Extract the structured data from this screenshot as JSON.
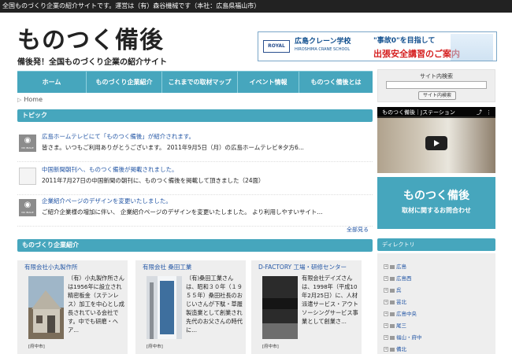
{
  "topbar": {
    "text": "全国ものづくり企業の紹介サイトです。運営は（有）森谷機械です（本社：広島県福山市）"
  },
  "logo": {
    "title": "ものつく備後",
    "subtitle": "備後発！全国ものづくり企業の紹介サイト"
  },
  "banner": {
    "royal": "ROYAL",
    "school": "広島クレーン学校",
    "school_en": "HIROSHIMA CRANE SCHOOL",
    "line1": "\"事故0\"を目指して",
    "line2": "出張安全講習のご案内"
  },
  "nav": {
    "items": [
      "ホーム",
      "ものづくり企業紹介",
      "これまでの取材マップ",
      "イベント情報",
      "ものつく備後とは"
    ]
  },
  "search": {
    "title": "サイト内検索",
    "button": "サイト内検索"
  },
  "breadcrumb": {
    "home": "Home"
  },
  "topics": {
    "title": "トピック",
    "items": [
      {
        "thumb": "NO IMAGE",
        "link": "広島ホームテレビにて「ものつく備後」が紹介されます。",
        "text": "皆さま。いつもご利用ありがとうございます。 2011年9月5日（月）の広島ホームテレビ※夕方6..."
      },
      {
        "thumb": "",
        "link": "中国新聞朝刊へ、ものつく備後が掲載されました。",
        "text": "2011年7月27日の中国新聞の朝刊に、ものつく備後を掲載して頂きました（24面）"
      },
      {
        "thumb": "NO IMAGE",
        "link": "企業紹介ページのデザインを変更いたしました。",
        "text": "ご紹介企業様の増加に伴い、 企業紹介ページのデザインを変更いたしました。 より利用しやすいサイト..."
      }
    ],
    "more": "全部見る"
  },
  "companies": {
    "title": "ものづくり企業紹介",
    "items": [
      {
        "name": "有限会社小丸製作所",
        "desc": "（有）小丸製作所さんは1956年に設立され精密板金（ステンレス）加工を中心とし成長されている会社です。中でも研磨・ヘア...",
        "city": "[府中市]"
      },
      {
        "name": "有限会社 桑田工業",
        "desc": "（有)桑田工業さんは、昭和３０年（１９５５年）桑田社長のおじいさんが下駄・草履製造業として創業され先代のお父さんの時代に...",
        "city": "[府中市]"
      },
      {
        "name": "D-FACTORY 工場・研修センター",
        "desc": "有限会社デイズさんは、1998年（平成10年2月25日）に、人材派遣サービス・アウトソーシングサービス事業として創業さ...",
        "city": "[府中市]"
      }
    ]
  },
  "video": {
    "title": "ものつく備後｜Jステーション"
  },
  "promo": {
    "line1": "ものつく備後",
    "line2": "取材に関するお問合わせ"
  },
  "directory": {
    "title": "ディレクトリ",
    "items": [
      "広島",
      "広島西",
      "呉",
      "芸北",
      "広島中央",
      "尾三",
      "福山・府中",
      "備北"
    ]
  },
  "colors": {
    "accent": "#46a6bd",
    "link": "#2356a5",
    "topbar": "#222222"
  }
}
